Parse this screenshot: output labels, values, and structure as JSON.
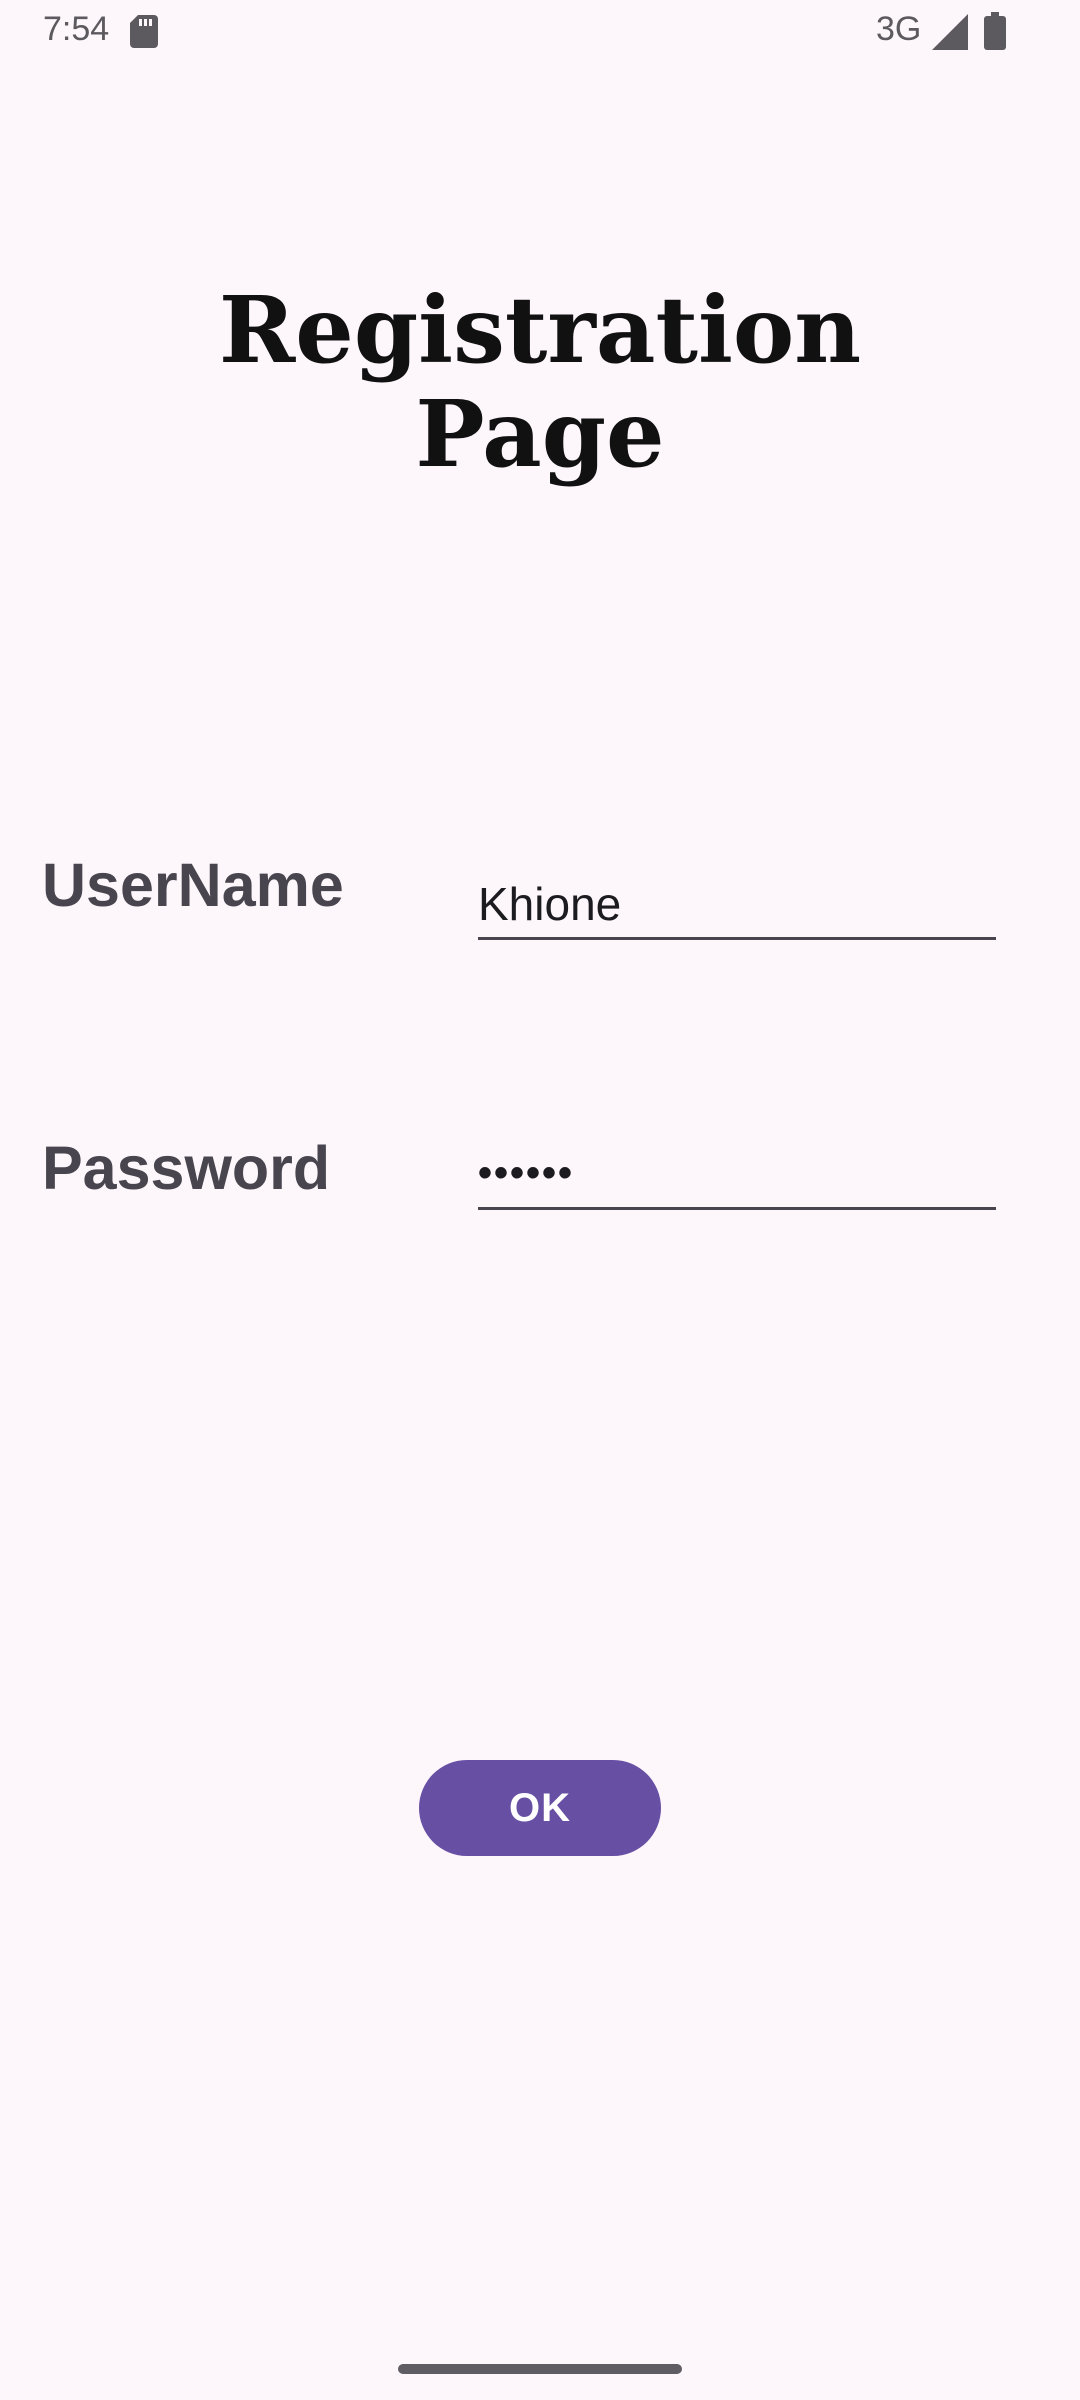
{
  "status_bar": {
    "time": "7:54",
    "network": "3G",
    "icons": [
      "sd-card-icon",
      "cell-signal-icon",
      "battery-icon"
    ]
  },
  "page": {
    "title_line1": "Registration",
    "title_line2": "Page"
  },
  "form": {
    "username_label": "UserName",
    "username_value": "Khione",
    "password_label": "Password",
    "password_value": "••••••",
    "ok_label": "OK"
  },
  "colors": {
    "background": "#FDF7FC",
    "accent": "#6750A4",
    "label_text": "#48454e",
    "title_text": "#111111"
  }
}
